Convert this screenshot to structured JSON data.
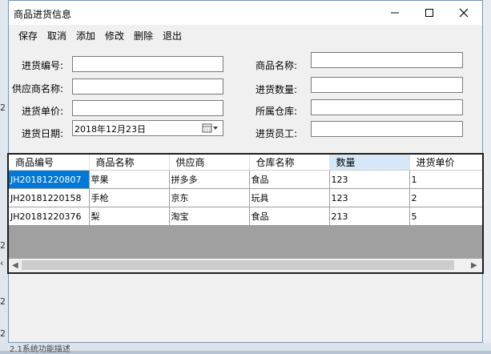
{
  "window": {
    "title": "商品进货信息"
  },
  "menu": [
    "保存",
    "取消",
    "添加",
    "修改",
    "删除",
    "退出"
  ],
  "form": {
    "labels": {
      "code": "进货编号:",
      "supplier": "供应商名称:",
      "price": "进货单价:",
      "date": "进货日期:",
      "name": "商品名称:",
      "quantity": "进货数量:",
      "warehouse": "所属仓库:",
      "staff": "进货员工:"
    },
    "values": {
      "code": "",
      "supplier": "",
      "price": "",
      "name": "",
      "quantity": "",
      "warehouse": "",
      "staff": ""
    },
    "date_value": "2018年12月23日"
  },
  "grid": {
    "columns": [
      "商品编号",
      "商品名称",
      "供应商",
      "仓库名称",
      "数量",
      "进货单价"
    ],
    "rows": [
      [
        "JH20181220807",
        "苹果",
        "拼多多",
        "食品",
        "123",
        "1"
      ],
      [
        "JH20181220158",
        "手枪",
        "京东",
        "玩具",
        "123",
        "2"
      ],
      [
        "JH20181220376",
        "梨",
        "淘宝",
        "食品",
        "213",
        "5"
      ]
    ]
  },
  "background": {
    "bottom_text": "2.1系统功能描述"
  },
  "colors": {
    "selection": "#0078d7",
    "header_selected": "#d6e8f8",
    "grid_empty": "#a0a0a0"
  }
}
